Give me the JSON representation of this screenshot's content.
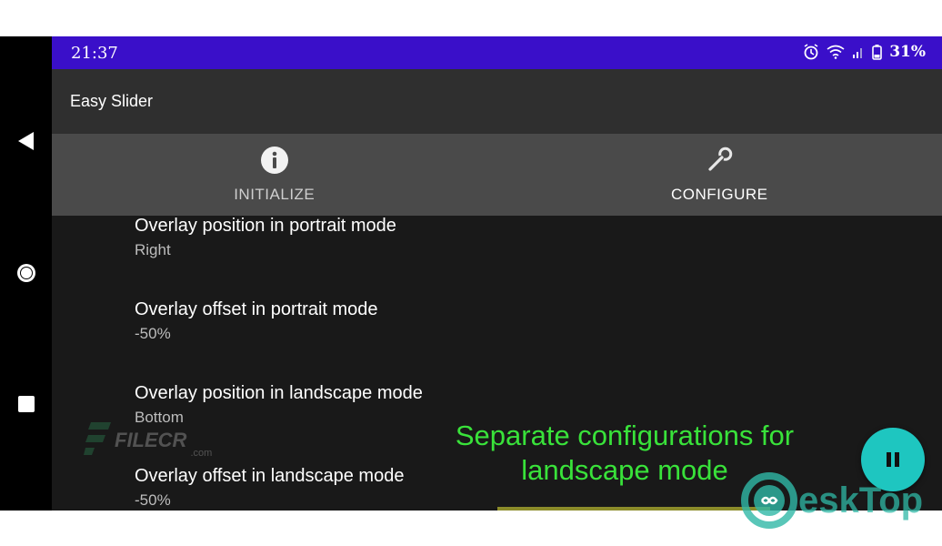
{
  "status_bar": {
    "time": "21:37",
    "battery": "31%",
    "icons": [
      "alarm-icon",
      "wifi-icon",
      "signal-icon",
      "battery-icon"
    ]
  },
  "app": {
    "title": "Easy Slider"
  },
  "tabs": [
    {
      "label": "INITIALIZE",
      "icon": "info-icon",
      "active": false
    },
    {
      "label": "CONFIGURE",
      "icon": "wrench-icon",
      "active": true
    }
  ],
  "settings": [
    {
      "title": "Overlay position in portrait mode",
      "value": "Right"
    },
    {
      "title": "Overlay offset in portrait mode",
      "value": "-50%"
    },
    {
      "title": "Overlay position in landscape mode",
      "value": "Bottom"
    },
    {
      "title": "Overlay offset in landscape mode",
      "value": "-50%"
    }
  ],
  "caption": {
    "line1": "Separate configurations for",
    "line2": "landscape mode"
  },
  "watermarks": {
    "filecr": "FILECR",
    "filecr_sub": ".com",
    "desktop": "eskTop"
  },
  "colors": {
    "status_bar": "#3a0fc9",
    "app_bar": "#2f2f2f",
    "tab_bar": "#4a4a4a",
    "background": "#191919",
    "caption": "#39e23a",
    "fab": "#1ec6c0"
  }
}
